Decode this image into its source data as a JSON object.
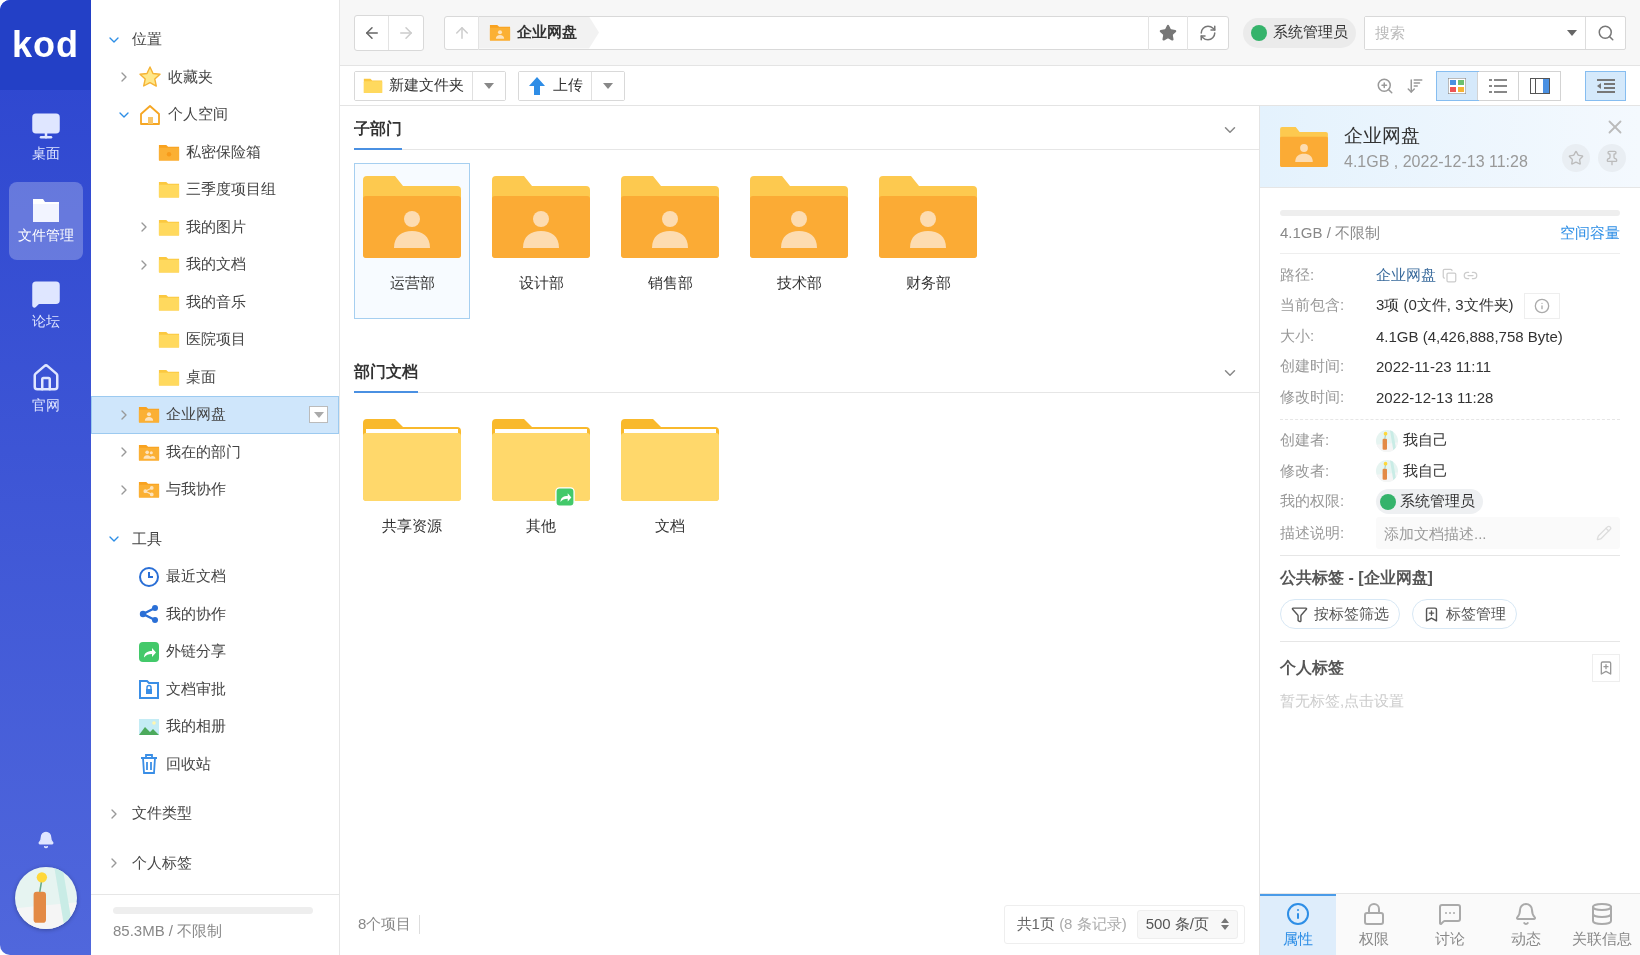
{
  "nav": {
    "logo": "kod",
    "items": [
      {
        "label": "桌面",
        "kind": "desktop",
        "selected": false
      },
      {
        "label": "文件管理",
        "kind": "files",
        "selected": true
      },
      {
        "label": "论坛",
        "kind": "forum",
        "selected": false
      },
      {
        "label": "官网",
        "kind": "home",
        "selected": false
      }
    ]
  },
  "tree": {
    "sections": [
      {
        "label": "位置",
        "expanded": true,
        "items": [
          {
            "label": "收藏夹",
            "kind": "star",
            "expanded": false,
            "selected": false
          },
          {
            "label": "个人空间",
            "kind": "home",
            "expanded": true,
            "selected": false,
            "children": [
              {
                "label": "私密保险箱",
                "kind": "safe",
                "selected": false
              },
              {
                "label": "三季度项目组",
                "kind": "folder",
                "selected": false
              },
              {
                "label": "我的图片",
                "kind": "folder",
                "expanded": false,
                "selected": false
              },
              {
                "label": "我的文档",
                "kind": "folder",
                "expanded": false,
                "selected": false
              },
              {
                "label": "我的音乐",
                "kind": "folder",
                "selected": false
              },
              {
                "label": "医院项目",
                "kind": "folder",
                "selected": false
              },
              {
                "label": "桌面",
                "kind": "folder",
                "selected": false
              }
            ]
          },
          {
            "label": "企业网盘",
            "kind": "org",
            "expanded": false,
            "selected": true
          },
          {
            "label": "我在的部门",
            "kind": "group",
            "expanded": false,
            "selected": false
          },
          {
            "label": "与我协作",
            "kind": "shared",
            "expanded": false,
            "selected": false
          }
        ]
      },
      {
        "label": "工具",
        "expanded": true,
        "items": [
          {
            "label": "最近文档",
            "kind": "recent",
            "selected": false
          },
          {
            "label": "我的协作",
            "kind": "nodes",
            "selected": false
          },
          {
            "label": "外链分享",
            "kind": "link",
            "selected": false
          },
          {
            "label": "文档审批",
            "kind": "approve",
            "selected": false
          },
          {
            "label": "我的相册",
            "kind": "album",
            "selected": false
          },
          {
            "label": "回收站",
            "kind": "trash",
            "selected": false
          }
        ]
      },
      {
        "label": "文件类型",
        "expanded": false
      },
      {
        "label": "个人标签",
        "expanded": false
      }
    ],
    "usage": {
      "text": "85.3MB / 不限制"
    }
  },
  "toolbar": {
    "back_disabled": false,
    "forward_disabled": true,
    "breadcrumb": "企业网盘",
    "user": "系统管理员",
    "search": {
      "placeholder": "搜索"
    },
    "actions": [
      {
        "label": "新建文件夹",
        "kind": "folder"
      },
      {
        "label": "上传",
        "kind": "upload"
      }
    ],
    "views": [
      {
        "kind": "icons",
        "selected": true
      },
      {
        "kind": "list",
        "selected": false
      },
      {
        "kind": "split",
        "selected": false
      }
    ],
    "panel_toggle": {
      "selected": true
    }
  },
  "sections": [
    {
      "title": "子部门",
      "expanded": true,
      "items": [
        {
          "label": "运营部",
          "kind": "dept",
          "selected": true,
          "shared": false
        },
        {
          "label": "设计部",
          "kind": "dept",
          "selected": false,
          "shared": false
        },
        {
          "label": "销售部",
          "kind": "dept",
          "selected": false,
          "shared": false
        },
        {
          "label": "技术部",
          "kind": "dept",
          "selected": false,
          "shared": false
        },
        {
          "label": "财务部",
          "kind": "dept",
          "selected": false,
          "shared": false
        }
      ]
    },
    {
      "title": "部门文档",
      "expanded": true,
      "items": [
        {
          "label": "共享资源",
          "kind": "plain",
          "selected": false,
          "shared": false
        },
        {
          "label": "其他",
          "kind": "plain",
          "selected": false,
          "shared": true
        },
        {
          "label": "文档",
          "kind": "plain",
          "selected": false,
          "shared": false
        }
      ]
    }
  ],
  "footer": {
    "count": "8个项目",
    "pages": "共1页",
    "records": "(8 条记录)",
    "page_size": "500 条/页"
  },
  "info": {
    "name": "企业网盘",
    "meta": "4.1GB , 2022-12-13 11:28",
    "usage": {
      "text": "4.1GB / 不限制",
      "link": "空间容量"
    },
    "props": [
      {
        "label": "路径:",
        "value": "企业网盘",
        "kind": "path"
      },
      {
        "label": "当前包含:",
        "value": "3项 (0文件, 3文件夹)",
        "kind": "count"
      },
      {
        "label": "大小:",
        "value": "4.1GB (4,426,888,758 Byte)",
        "kind": "text"
      },
      {
        "label": "创建时间:",
        "value": "2022-11-23 11:11",
        "kind": "text"
      },
      {
        "label": "修改时间:",
        "value": "2022-12-13 11:28",
        "kind": "text"
      }
    ],
    "people": [
      {
        "label": "创建者:",
        "value": "我自己",
        "kind": "user"
      },
      {
        "label": "修改者:",
        "value": "我自己",
        "kind": "user"
      },
      {
        "label": "我的权限:",
        "value": "系统管理员",
        "kind": "role"
      },
      {
        "label": "描述说明:",
        "placeholder": "添加文档描述...",
        "kind": "desc"
      }
    ],
    "public_tags": {
      "title": "公共标签 - [企业网盘]",
      "buttons": [
        {
          "label": "按标签筛选",
          "kind": "filter"
        },
        {
          "label": "标签管理",
          "kind": "manage"
        }
      ]
    },
    "personal_tags": {
      "title": "个人标签",
      "empty": "暂无标签,点击设置"
    },
    "tabs": [
      {
        "label": "属性",
        "kind": "info",
        "selected": true
      },
      {
        "label": "权限",
        "kind": "lock",
        "selected": false
      },
      {
        "label": "讨论",
        "kind": "chat",
        "selected": false
      },
      {
        "label": "动态",
        "kind": "bell",
        "selected": false
      },
      {
        "label": "关联信息",
        "kind": "db",
        "selected": false
      }
    ]
  }
}
